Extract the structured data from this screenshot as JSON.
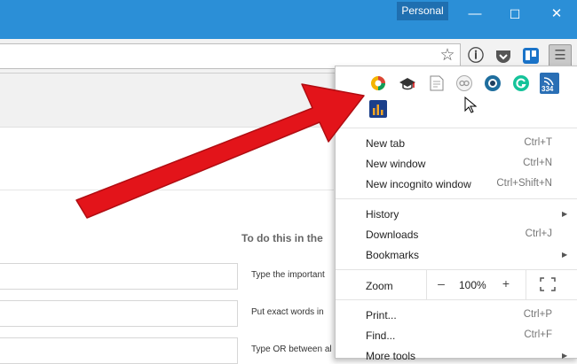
{
  "window": {
    "profile_label": "Personal",
    "minimize_glyph": "—",
    "maximize_glyph": "☐",
    "close_glyph": "✕"
  },
  "toolbar": {
    "star_glyph": "☆",
    "info_glyph": "ⓘ",
    "menu_glyph": "☰"
  },
  "page": {
    "to_do_heading": "To do this in the",
    "hints": [
      "Type the important",
      "Put exact words in",
      "Type OR between al"
    ]
  },
  "menu": {
    "extensions_row1": [
      "colorful-wheel-icon",
      "graduation-cap-icon",
      "note-icon",
      "pair-link-icon",
      "blue-eye-icon",
      "grammarly-icon",
      "rss-counter-icon"
    ],
    "rss_counter": "334",
    "items": [
      {
        "label": "New tab",
        "shortcut": "Ctrl+T"
      },
      {
        "label": "New window",
        "shortcut": "Ctrl+N"
      },
      {
        "label": "New incognito window",
        "shortcut": "Ctrl+Shift+N"
      },
      {
        "label": "History",
        "shortcut": ""
      },
      {
        "label": "Downloads",
        "shortcut": "Ctrl+J"
      },
      {
        "label": "Bookmarks",
        "shortcut": ""
      },
      {
        "label": "Print...",
        "shortcut": "Ctrl+P"
      },
      {
        "label": "Find...",
        "shortcut": "Ctrl+F"
      },
      {
        "label": "More tools",
        "shortcut": ""
      }
    ],
    "zoom": {
      "label": "Zoom",
      "minus": "–",
      "value": "100%",
      "plus": "+"
    }
  },
  "colors": {
    "titlebar": "#2b8fd7",
    "arrow": "#e3141a"
  }
}
